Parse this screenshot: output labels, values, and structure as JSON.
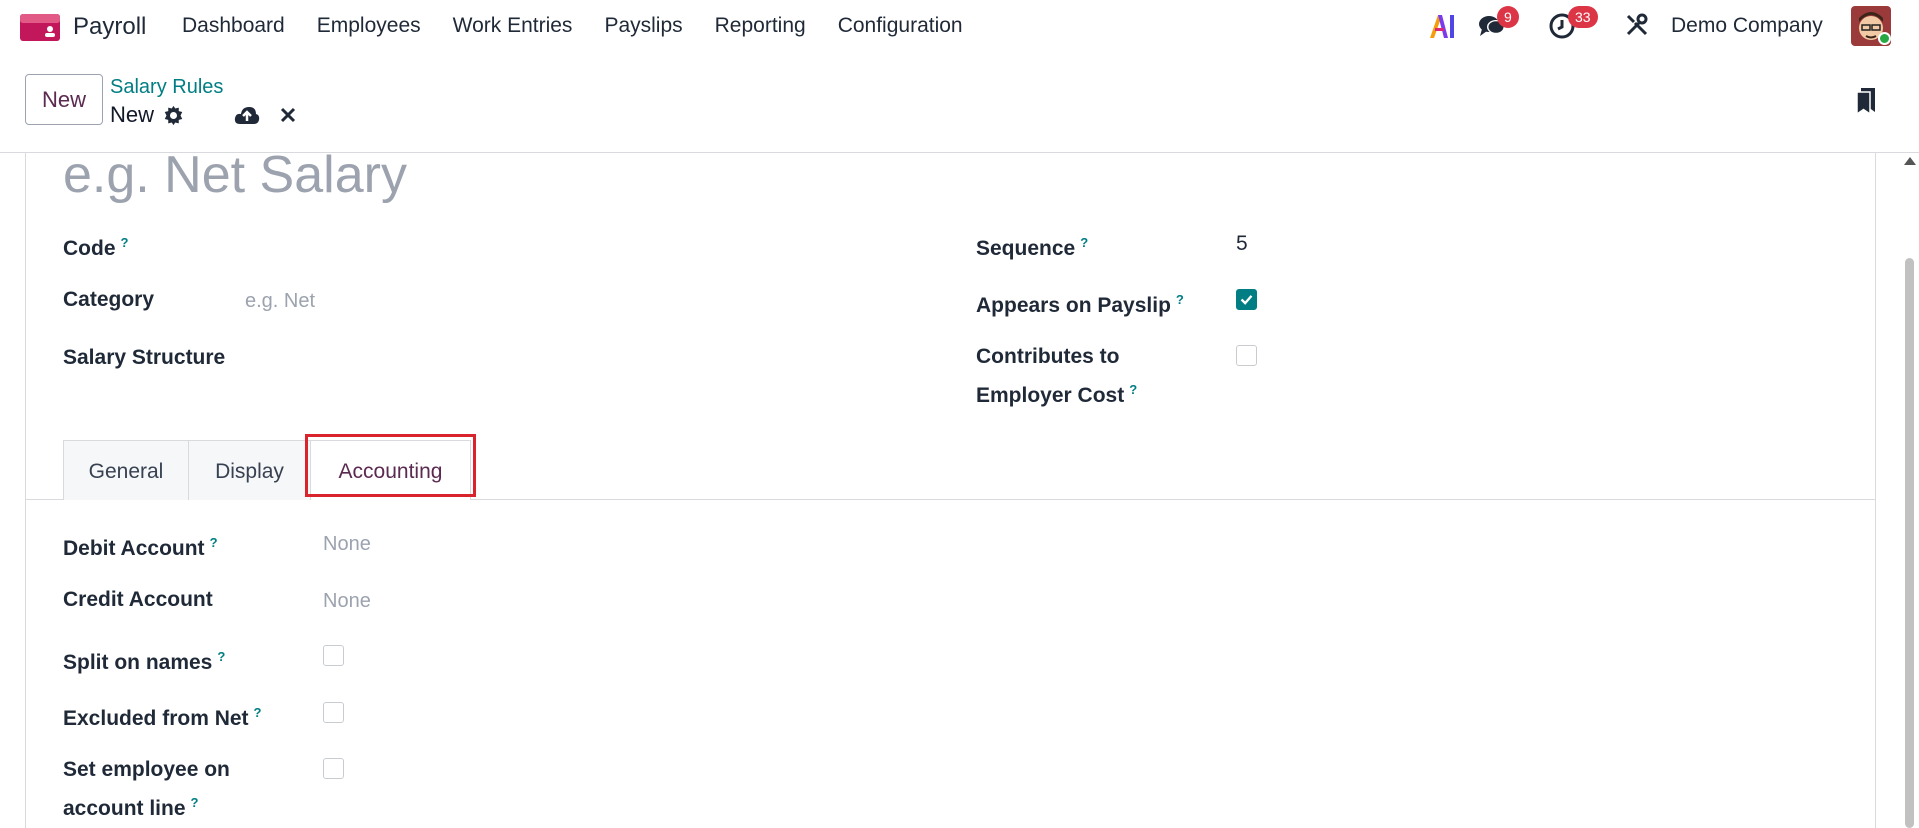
{
  "navbar": {
    "app_name": "Payroll",
    "menu": [
      "Dashboard",
      "Employees",
      "Work Entries",
      "Payslips",
      "Reporting",
      "Configuration"
    ],
    "messages_badge": "9",
    "activities_badge": "33",
    "company": "Demo Company"
  },
  "control_panel": {
    "new_label": "New",
    "breadcrumb_parent": "Salary Rules",
    "breadcrumb_current": "New"
  },
  "form": {
    "name_placeholder": "e.g. Net Salary",
    "code_label": "Code",
    "category_label": "Category",
    "category_placeholder": "e.g. Net",
    "structure_label": "Salary Structure",
    "sequence_label": "Sequence",
    "sequence_value": "5",
    "appears_label": "Appears on Payslip",
    "appears_checked": true,
    "contributes_label_1": "Contributes to",
    "contributes_label_2": "Employer Cost",
    "contributes_checked": false,
    "help_mark": "?"
  },
  "tabs": [
    "General",
    "Display",
    "Accounting"
  ],
  "accounting": {
    "debit_label": "Debit Account",
    "debit_value": "None",
    "credit_label": "Credit Account",
    "credit_value": "None",
    "split_label": "Split on names",
    "excluded_label": "Excluded from Net",
    "set_employee_label_1": "Set employee on",
    "set_employee_label_2": "account line"
  },
  "colors": {
    "brand": "#5b2a50",
    "accent": "#017e84",
    "badge": "#dc3545",
    "highlight": "#d9232d"
  }
}
